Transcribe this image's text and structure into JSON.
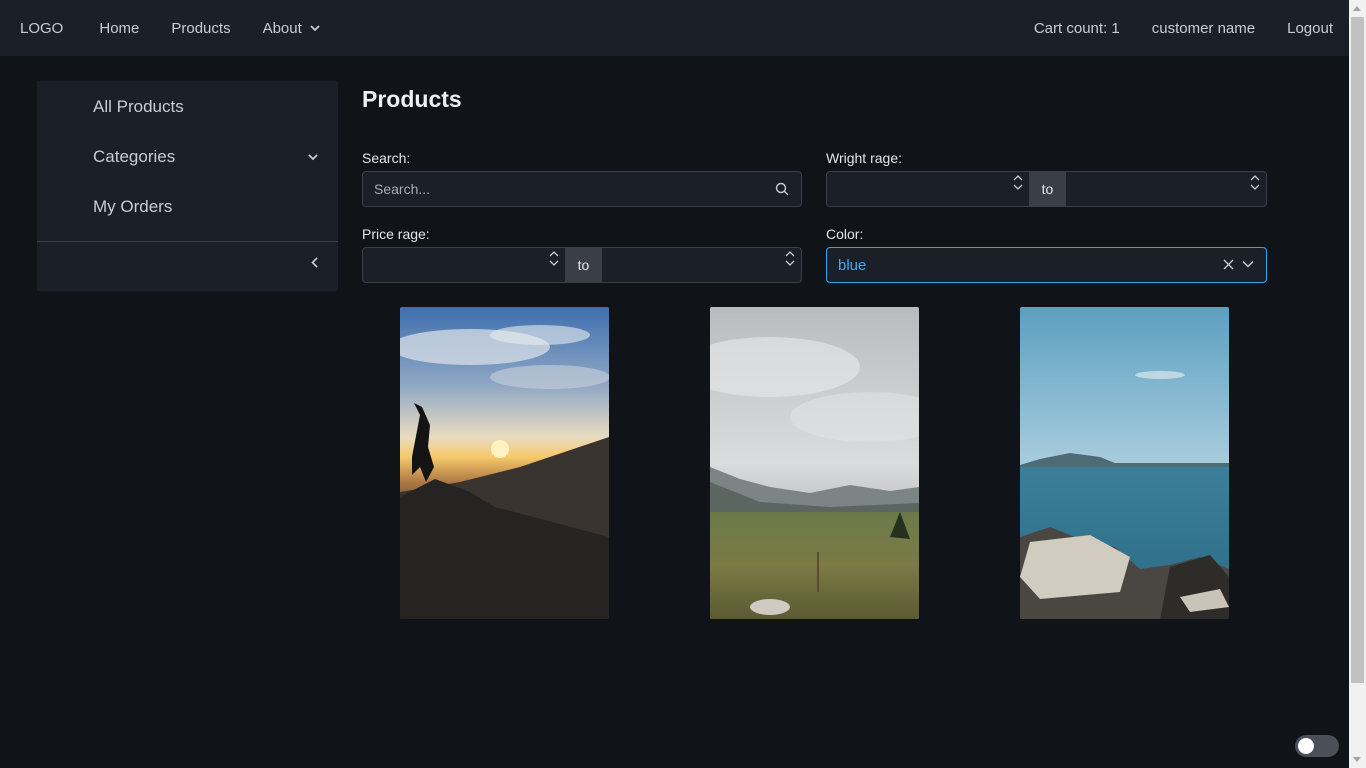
{
  "header": {
    "logo": "LOGO",
    "nav": {
      "home": "Home",
      "products": "Products",
      "about": "About"
    },
    "cart_count": "Cart count: 1",
    "customer_name": "customer name",
    "logout": "Logout"
  },
  "sidebar": {
    "items": [
      {
        "label": "All Products"
      },
      {
        "label": "Categories"
      },
      {
        "label": "My Orders"
      }
    ]
  },
  "main": {
    "title": "Products",
    "search": {
      "label": "Search:",
      "placeholder": "Search...",
      "value": ""
    },
    "weight_range": {
      "label": "Wright rage:",
      "to": "to",
      "from_value": "",
      "to_value": ""
    },
    "price_range": {
      "label": "Price rage:",
      "to": "to",
      "from_value": "",
      "to_value": ""
    },
    "color": {
      "label": "Color:",
      "value": "blue"
    }
  },
  "products": [
    {
      "image": "sunset-mountain-silhouette"
    },
    {
      "image": "cloudy-meadow-mountains"
    },
    {
      "image": "lake-rocky-shore"
    }
  ],
  "colors": {
    "page_bg": "#101418",
    "panel_bg": "#1b1f28",
    "accent": "#2ea6f5",
    "toggle_bg": "#4b4f58"
  },
  "icons": {
    "search": "search-icon",
    "about_chevron": "chevron-down-icon",
    "categories_chevron": "chevron-down-icon",
    "collapse": "chevron-left-icon",
    "clear": "close-icon",
    "select_chevron": "chevron-down-icon"
  }
}
